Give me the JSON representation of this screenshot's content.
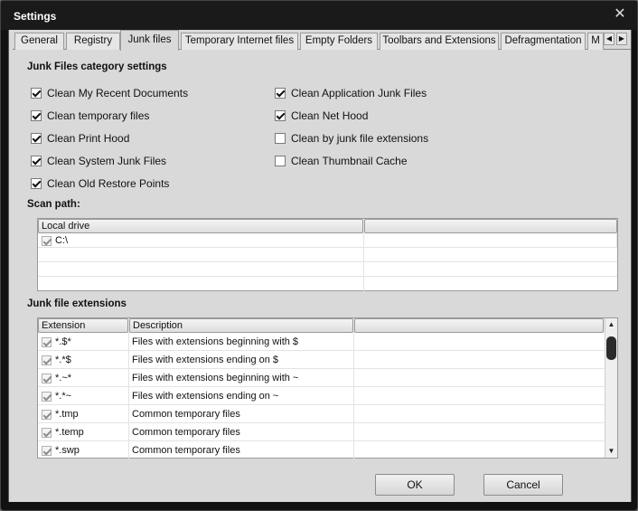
{
  "window": {
    "title": "Settings",
    "close_glyph": "✕"
  },
  "tabs": [
    {
      "label": "General"
    },
    {
      "label": "Registry"
    },
    {
      "label": "Junk files"
    },
    {
      "label": "Temporary Internet files"
    },
    {
      "label": "Empty Folders"
    },
    {
      "label": "Toolbars and Extensions"
    },
    {
      "label": "Defragmentation"
    },
    {
      "label": "M"
    }
  ],
  "tab_scroll": {
    "left": "◀",
    "right": "▶"
  },
  "category": {
    "title": "Junk Files category settings",
    "left_options": [
      {
        "label": "Clean My Recent Documents",
        "checked": true
      },
      {
        "label": "Clean temporary files",
        "checked": true
      },
      {
        "label": "Clean Print Hood",
        "checked": true
      },
      {
        "label": "Clean System Junk Files",
        "checked": true
      },
      {
        "label": "Clean Old Restore Points",
        "checked": true
      }
    ],
    "right_options": [
      {
        "label": "Clean Application Junk Files",
        "checked": true
      },
      {
        "label": "Clean Net Hood",
        "checked": true
      },
      {
        "label": "Clean by junk file extensions",
        "checked": false
      },
      {
        "label": "Clean Thumbnail Cache",
        "checked": false
      }
    ]
  },
  "scan_path": {
    "title": "Scan path:",
    "columns": [
      "Local drive",
      ""
    ],
    "rows": [
      {
        "path": "C:\\",
        "checked": true
      }
    ]
  },
  "extensions": {
    "title": "Junk file extensions",
    "columns": [
      "Extension",
      "Description",
      ""
    ],
    "rows": [
      {
        "ext": "*.$*",
        "desc": "Files with extensions beginning with $",
        "checked": true
      },
      {
        "ext": "*.*$",
        "desc": "Files with extensions ending on $",
        "checked": true
      },
      {
        "ext": "*.~*",
        "desc": "Files with extensions beginning with ~",
        "checked": true
      },
      {
        "ext": "*.*~",
        "desc": "Files with extensions ending on ~",
        "checked": true
      },
      {
        "ext": "*.tmp",
        "desc": "Common temporary files",
        "checked": true
      },
      {
        "ext": "*.temp",
        "desc": "Common temporary files",
        "checked": true
      },
      {
        "ext": "*.swp",
        "desc": "Common temporary files",
        "checked": true
      }
    ],
    "scroll": {
      "up": "▲",
      "down": "▼"
    }
  },
  "buttons": {
    "ok": "OK",
    "cancel": "Cancel"
  }
}
